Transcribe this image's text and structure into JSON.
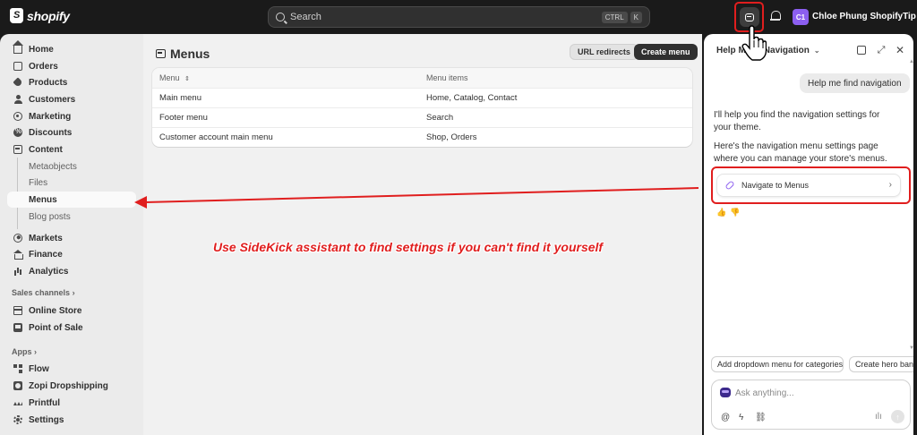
{
  "topbar": {
    "brand": "shopify",
    "search_placeholder": "Search",
    "shortcut_keys": [
      "CTRL",
      "K"
    ],
    "avatar_initials": "C1",
    "store_name": "Chloe Phung ShopifyTip ..."
  },
  "sidebar": {
    "items": [
      {
        "label": "Home",
        "icon": "home-icon"
      },
      {
        "label": "Orders",
        "icon": "inbox-icon"
      },
      {
        "label": "Products",
        "icon": "tag-icon"
      },
      {
        "label": "Customers",
        "icon": "person-icon"
      },
      {
        "label": "Marketing",
        "icon": "target-icon"
      },
      {
        "label": "Discounts",
        "icon": "discount-icon"
      },
      {
        "label": "Content",
        "icon": "content-icon"
      }
    ],
    "content_subitems": [
      "Metaobjects",
      "Files",
      "Menus",
      "Blog posts"
    ],
    "items2": [
      {
        "label": "Markets",
        "icon": "globe-icon"
      },
      {
        "label": "Finance",
        "icon": "bank-icon"
      },
      {
        "label": "Analytics",
        "icon": "bar-chart-icon"
      }
    ],
    "sales_channels_label": "Sales channels",
    "sales_channels": [
      {
        "label": "Online Store",
        "icon": "store-icon"
      },
      {
        "label": "Point of Sale",
        "icon": "pos-icon"
      }
    ],
    "apps_label": "Apps",
    "apps": [
      {
        "label": "Flow",
        "icon": "flow-icon"
      },
      {
        "label": "Zopi Dropshipping",
        "icon": "zopi-icon"
      },
      {
        "label": "Printful",
        "icon": "printful-icon"
      }
    ],
    "settings_label": "Settings"
  },
  "main": {
    "title": "Menus",
    "url_redirects_label": "URL redirects",
    "create_menu_label": "Create menu",
    "table": {
      "headers": [
        "Menu",
        "Menu items"
      ],
      "rows": [
        [
          "Main menu",
          "Home, Catalog, Contact"
        ],
        [
          "Footer menu",
          "Search"
        ],
        [
          "Customer account main menu",
          "Shop, Orders"
        ]
      ]
    },
    "annotation": "Use SideKick assistant to find settings if you can't find it yourself"
  },
  "sidekick": {
    "title_part1": "Help M",
    "title_part2": "Navigation",
    "user_message": "Help me find navigation",
    "reply_1": "I'll help you find the navigation settings for your theme.",
    "reply_2": "Here's the navigation menu settings page where you can manage your store's menus.",
    "nav_card_label": "Navigate to Menus",
    "suggestions": [
      "Add dropdown menu for categories",
      "Create hero ban"
    ],
    "composer_placeholder": "Ask anything..."
  },
  "colors": {
    "annotation_red": "#e01e1e",
    "avatar_purple": "#8c5ff0",
    "topbar_bg": "#1a1a1a"
  }
}
